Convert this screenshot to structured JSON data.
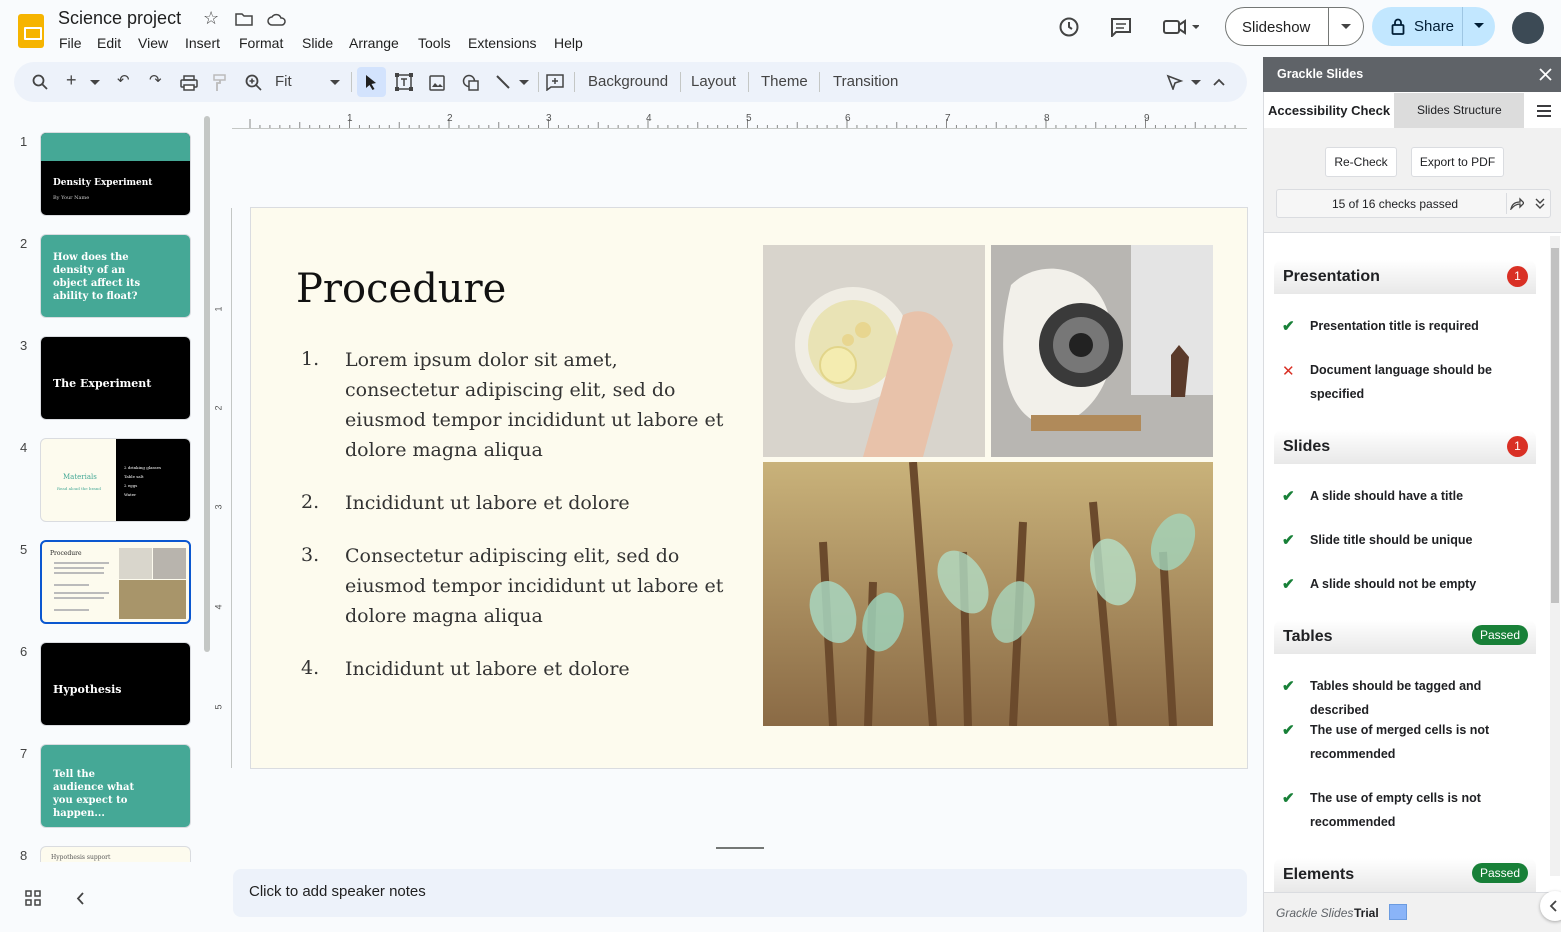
{
  "doc": {
    "title": "Science project"
  },
  "menu": [
    "File",
    "Edit",
    "View",
    "Insert",
    "Format",
    "Slide",
    "Arrange",
    "Tools",
    "Extensions",
    "Help"
  ],
  "header": {
    "slideshow_label": "Slideshow",
    "share_label": "Share"
  },
  "toolbar": {
    "zoom": "Fit",
    "background": "Background",
    "layout": "Layout",
    "theme": "Theme",
    "transition": "Transition"
  },
  "filmstrip": {
    "slides": [
      {
        "num": "1",
        "title": "Density Experiment",
        "subtitle": "By Your Name"
      },
      {
        "num": "2",
        "title": "How does the density of an object affect its ability to float?"
      },
      {
        "num": "3",
        "title": "The Experiment"
      },
      {
        "num": "4",
        "title": "Materials",
        "subtitle": "Read aloud the brand",
        "bullets": [
          "2 drinking glasses",
          "Table salt",
          "2 eggs",
          "Water"
        ]
      },
      {
        "num": "5",
        "title": "Procedure"
      },
      {
        "num": "6",
        "title": "Hypothesis"
      },
      {
        "num": "7",
        "title": "Tell the audience what you expect to happen..."
      },
      {
        "num": "8",
        "title": "Hypothesis support"
      }
    ],
    "selected": 5
  },
  "slide": {
    "title": "Procedure",
    "items": [
      {
        "num": "1.",
        "text": "Lorem ipsum dolor sit amet, consectetur adipiscing elit, sed do eiusmod tempor incididunt ut labore et dolore magna aliqua"
      },
      {
        "num": "2.",
        "text": "Incididunt ut labore et dolore"
      },
      {
        "num": "3.",
        "text": "Consectetur adipiscing elit, sed do eiusmod tempor incididunt ut labore et dolore magna aliqua"
      },
      {
        "num": "4.",
        "text": "Incididunt ut labore et dolore"
      }
    ]
  },
  "ruler": {
    "top": [
      "1",
      "2",
      "3",
      "4",
      "5",
      "6",
      "7",
      "8",
      "9"
    ],
    "left": [
      "1",
      "2",
      "3",
      "4",
      "5"
    ]
  },
  "notes": {
    "placeholder": "Click to add speaker notes"
  },
  "panel": {
    "title": "Grackle Slides",
    "tabs": [
      "Accessibility Check",
      "Slides Structure"
    ],
    "recheck": "Re-Check",
    "export": "Export to PDF",
    "summary": "15 of 16 checks passed",
    "sections": [
      {
        "name": "Presentation",
        "badge": "1",
        "items": [
          {
            "status": "pass",
            "text": "Presentation title is required"
          },
          {
            "status": "fail",
            "text": "Document language should be specified"
          }
        ]
      },
      {
        "name": "Slides",
        "badge": "1",
        "items": [
          {
            "status": "pass",
            "text": "A slide should have a title"
          },
          {
            "status": "pass",
            "text": "Slide title should be unique"
          },
          {
            "status": "pass",
            "text": "A slide should not be empty"
          }
        ]
      },
      {
        "name": "Tables",
        "badge": "Passed",
        "items": [
          {
            "status": "pass",
            "text": "Tables should be tagged and described"
          },
          {
            "status": "pass",
            "text": "The use of merged cells is not recommended"
          },
          {
            "status": "pass",
            "text": "The use of empty cells is not recommended"
          }
        ]
      },
      {
        "name": "Elements",
        "badge": "Passed",
        "items": []
      }
    ],
    "footer_brand": "Grackle Slides",
    "footer_trial": "Trial"
  },
  "colors": {
    "teal": "#45a896",
    "accent": "#0b57d0",
    "share": "#c2e7ff",
    "pass": "#188038",
    "fail": "#d93025"
  }
}
